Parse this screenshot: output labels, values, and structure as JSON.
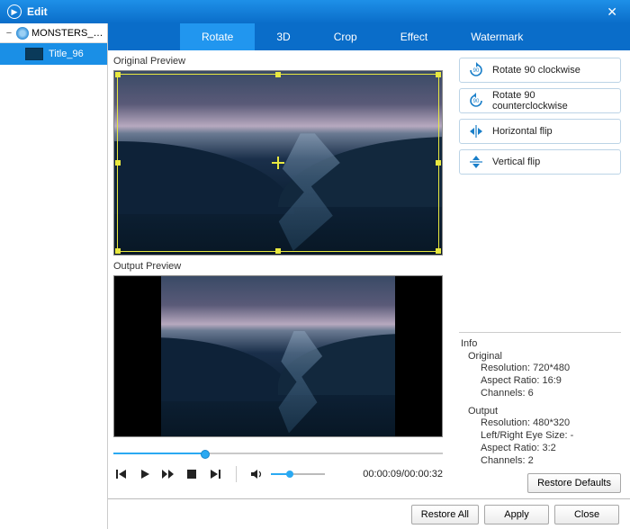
{
  "titlebar": {
    "title": "Edit"
  },
  "sidebar": {
    "disc_label": "MONSTERS_U...",
    "items": [
      {
        "label": "Title_96"
      }
    ]
  },
  "tabs": [
    {
      "label": "Rotate",
      "active": true
    },
    {
      "label": "3D"
    },
    {
      "label": "Crop"
    },
    {
      "label": "Effect"
    },
    {
      "label": "Watermark"
    }
  ],
  "preview": {
    "original_label": "Original Preview",
    "output_label": "Output Preview"
  },
  "rotate_options": [
    {
      "key": "rotate-cw",
      "label": "Rotate 90 clockwise"
    },
    {
      "key": "rotate-ccw",
      "label": "Rotate 90 counterclockwise"
    },
    {
      "key": "flip-h",
      "label": "Horizontal flip"
    },
    {
      "key": "flip-v",
      "label": "Vertical flip"
    }
  ],
  "playback": {
    "seek_percent": 28,
    "volume_percent": 35,
    "time_current": "00:00:09",
    "time_total": "00:00:32"
  },
  "info": {
    "header": "Info",
    "original": {
      "header": "Original",
      "resolution_label": "Resolution:",
      "resolution_value": "720*480",
      "aspect_label": "Aspect Ratio:",
      "aspect_value": "16:9",
      "channels_label": "Channels:",
      "channels_value": "6"
    },
    "output": {
      "header": "Output",
      "resolution_label": "Resolution:",
      "resolution_value": "480*320",
      "eyesize_label": "Left/Right Eye Size:",
      "eyesize_value": "-",
      "aspect_label": "Aspect Ratio:",
      "aspect_value": "3:2",
      "channels_label": "Channels:",
      "channels_value": "2"
    }
  },
  "buttons": {
    "restore_defaults": "Restore Defaults",
    "restore_all": "Restore All",
    "apply": "Apply",
    "close": "Close"
  }
}
